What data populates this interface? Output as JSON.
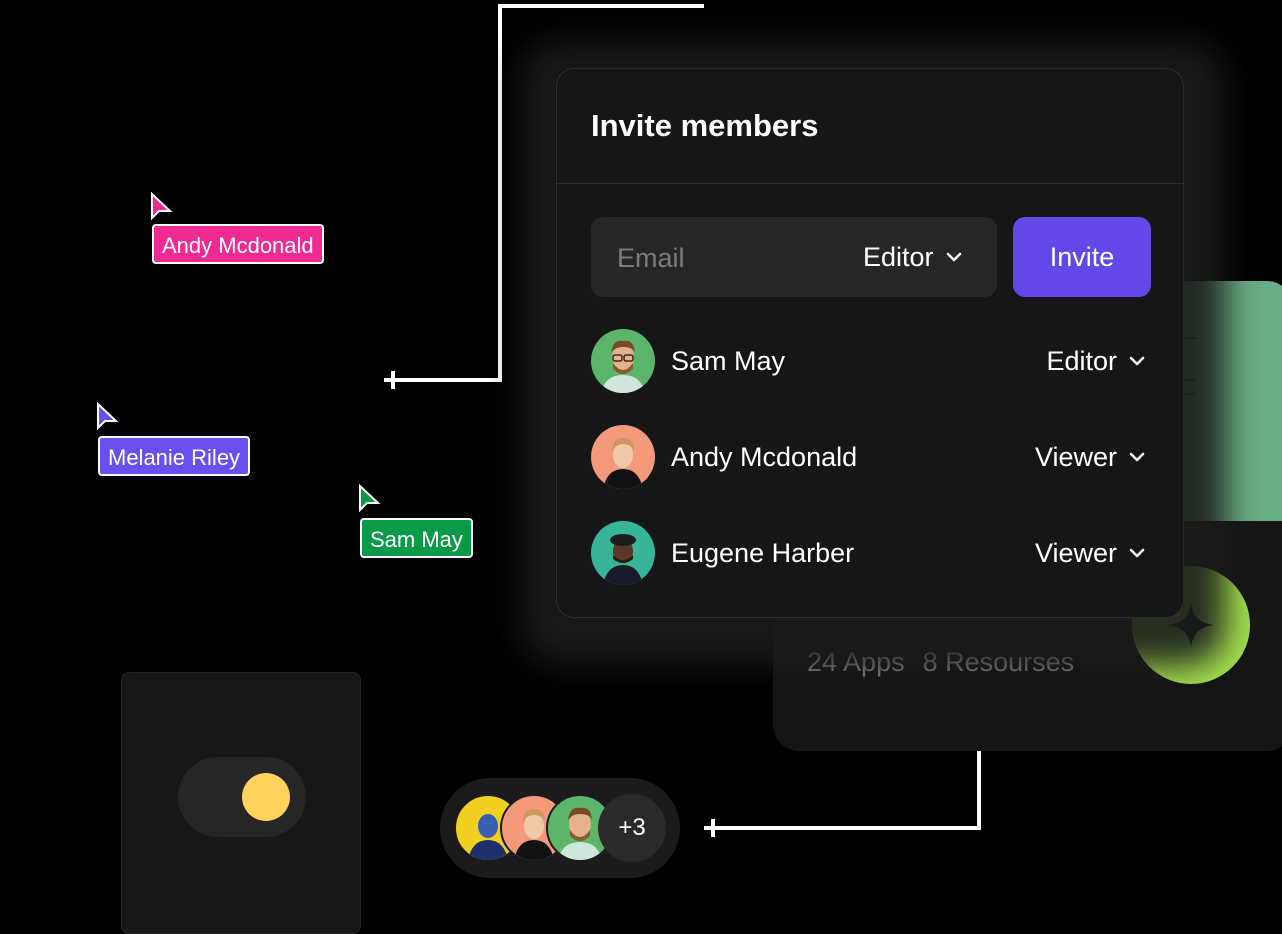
{
  "modal": {
    "title": "Invite members",
    "email_placeholder": "Email",
    "default_role": "Editor",
    "invite_label": "Invite"
  },
  "members": [
    {
      "name": "Sam May",
      "role": "Editor",
      "avatar_color": "#5bb56a"
    },
    {
      "name": "Andy Mcdonald",
      "role": "Viewer",
      "avatar_color": "#f49a7b"
    },
    {
      "name": "Eugene Harber",
      "role": "Viewer",
      "avatar_color": "#37b596"
    }
  ],
  "cursor_tags": [
    {
      "name": "Andy Mcdonald",
      "color": "#f02a93"
    },
    {
      "name": "Melanie Riley",
      "color": "#6a4ef0"
    },
    {
      "name": "Sam May",
      "color": "#0a9a48"
    }
  ],
  "project": {
    "apps": "24 Apps",
    "resources": "8 Resourses"
  },
  "stack": {
    "more_label": "+3",
    "colors": [
      "#f2d022",
      "#f49a7b",
      "#5bb56a"
    ]
  },
  "toggle": {
    "on": true,
    "knob_color": "#ffd25b"
  }
}
